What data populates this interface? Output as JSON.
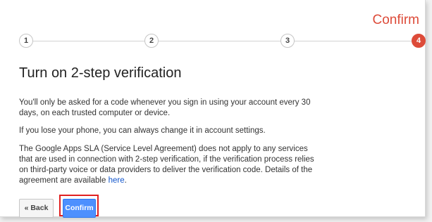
{
  "header": {
    "step_title": "Confirm",
    "steps": [
      "1",
      "2",
      "3",
      "4"
    ],
    "active_step": 4
  },
  "main": {
    "title": "Turn on 2-step verification",
    "paragraph1": "You'll only be asked for a code whenever you sign in using your account every 30 days, on each trusted computer or device.",
    "paragraph2": "If you lose your phone, you can always change it in account settings.",
    "paragraph3": "The Google Apps SLA (Service Level Agreement) does not apply to any services that are used in connection with 2-step verification, if the verification process relies on third-party voice or data providers to deliver the verification code. Details of the agreement are available ",
    "link_text": "here",
    "paragraph3_end": "."
  },
  "buttons": {
    "back_label": "« Back",
    "confirm_label": "Confirm"
  },
  "colors": {
    "accent_red": "#dd4b39",
    "primary_blue": "#4d90fe",
    "link_blue": "#1155cc",
    "highlight_red": "#e02020"
  }
}
